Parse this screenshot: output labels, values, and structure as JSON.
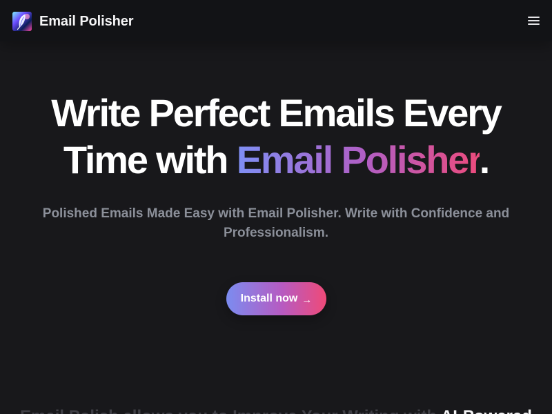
{
  "navbar": {
    "brand": "Email Polisher",
    "logo_icon": "quill-logo-icon",
    "menu_icon": "hamburger-menu-icon"
  },
  "hero": {
    "title_lead": "Write Perfect Emails Every Time with",
    "title_highlight": "Email Polisher",
    "title_end": ".",
    "subtitle": "Polished Emails Made Easy with Email Polisher. Write with Confidence and Professionalism.",
    "cta_label": "Install now",
    "cta_arrow": "→"
  },
  "lower_section": {
    "text": "Email Polish allows you to Improve Your Writing with ",
    "emphasis": "AI-Powered"
  },
  "colors": {
    "background": "#18181b",
    "navbar": "#121316",
    "gradient_start": "#7f8ff4",
    "gradient_middle": "#b05fc5",
    "gradient_end": "#ec4b7d",
    "subtitle": "#8b8f99"
  }
}
